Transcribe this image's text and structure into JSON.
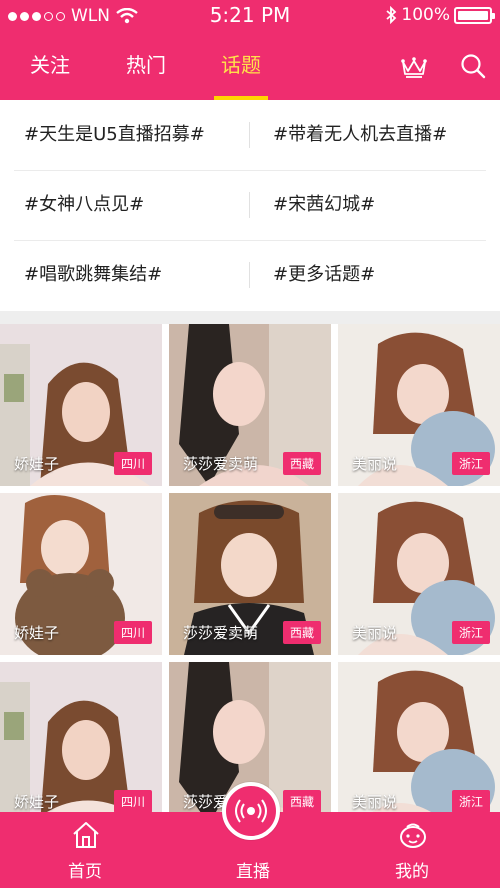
{
  "status_bar": {
    "carrier": "WLN",
    "time": "5:21 PM",
    "battery": "100%"
  },
  "nav": {
    "tabs": [
      {
        "label": "关注"
      },
      {
        "label": "热门"
      },
      {
        "label": "话题",
        "active": true
      }
    ],
    "icons": [
      "crown-icon",
      "search-icon"
    ]
  },
  "topics": [
    "#天生是U5直播招募#",
    "#带着无人机去直播#",
    "#女神八点见#",
    "#宋茜幻城#",
    "#唱歌跳舞集结#",
    "#更多话题#"
  ],
  "cards": [
    {
      "name": "娇娃子",
      "region": "四川"
    },
    {
      "name": "莎莎爱卖萌",
      "region": "西藏"
    },
    {
      "name": "美丽说",
      "region": "浙江"
    },
    {
      "name": "娇娃子",
      "region": "四川"
    },
    {
      "name": "莎莎爱卖萌",
      "region": "西藏"
    },
    {
      "name": "美丽说",
      "region": "浙江"
    },
    {
      "name": "娇娃子",
      "region": "四川"
    },
    {
      "name": "莎莎爱",
      "region": "西藏"
    },
    {
      "name": "美丽说",
      "region": "浙江"
    }
  ],
  "tabbar": {
    "home": "首页",
    "live": "直播",
    "mine": "我的"
  },
  "colors": {
    "primary": "#ef2d6f",
    "active_tab": "#ffe14a"
  }
}
